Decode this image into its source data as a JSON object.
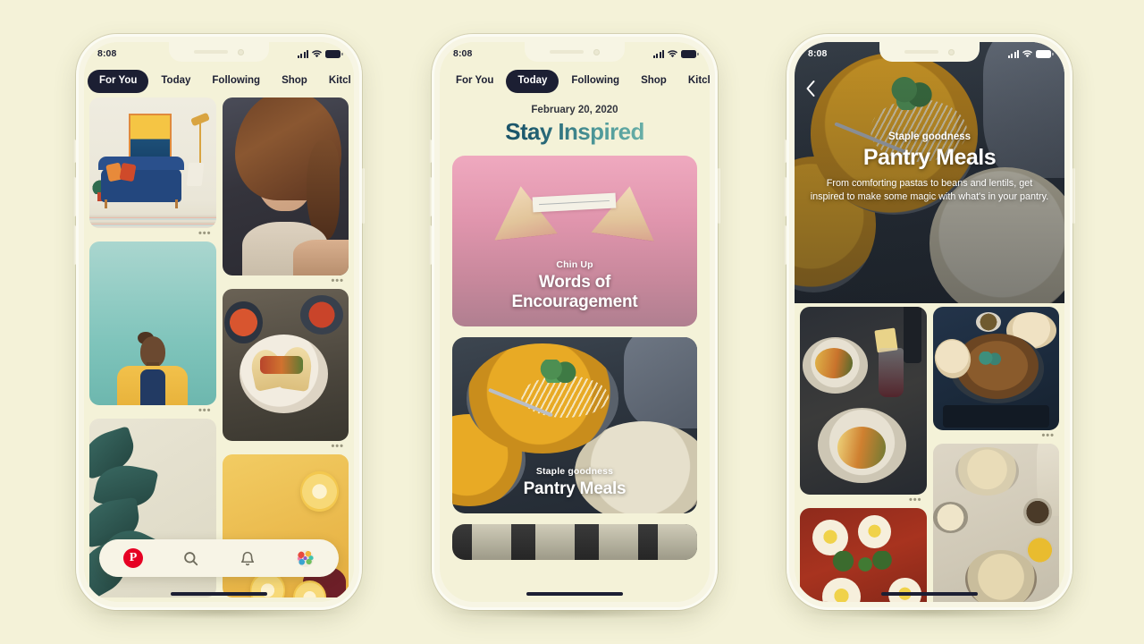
{
  "page": {
    "background_color": "#f4f2d8",
    "device_frame_color": "#f7f5e4"
  },
  "status_bar": {
    "time": "8:08",
    "icons": [
      "cellular-signal-icon",
      "wifi-icon",
      "battery-icon"
    ]
  },
  "phone1": {
    "name": "For You feed",
    "tabs": [
      {
        "label": "For You",
        "active": true
      },
      {
        "label": "Today",
        "active": false
      },
      {
        "label": "Following",
        "active": false
      },
      {
        "label": "Shop",
        "active": false
      },
      {
        "label": "Kitcl",
        "active": false
      }
    ],
    "pins": [
      {
        "name": "living-room-illustration",
        "overflow": "•••"
      },
      {
        "name": "woman-in-yellow-jacket-photo",
        "overflow": "•••"
      },
      {
        "name": "rubber-plant-photo",
        "overflow": ""
      },
      {
        "name": "portrait-woman-photo",
        "overflow": "•••"
      },
      {
        "name": "tacos-plate-photo",
        "overflow": "•••"
      },
      {
        "name": "citrus-yellow-photo",
        "overflow": ""
      }
    ],
    "nav": [
      {
        "name": "home",
        "icon": "pinterest-logo-icon",
        "glyph": "P"
      },
      {
        "name": "search",
        "icon": "search-icon"
      },
      {
        "name": "notifications",
        "icon": "bell-icon"
      },
      {
        "name": "profile",
        "icon": "avatar-icon"
      }
    ]
  },
  "phone2": {
    "name": "Today tab",
    "tabs": [
      {
        "label": "For You",
        "active": false
      },
      {
        "label": "Today",
        "active": true
      },
      {
        "label": "Following",
        "active": false
      },
      {
        "label": "Shop",
        "active": false
      },
      {
        "label": "Kitcl",
        "active": false
      }
    ],
    "date": "February 20, 2020",
    "headline": "Stay Inspired",
    "headline_gradient": [
      "#17485e",
      "#86c7b6"
    ],
    "cards": [
      {
        "name": "words-of-encouragement-card",
        "eyebrow": "Chin Up",
        "title_line1": "Words of",
        "title_line2": "Encouragement",
        "accent": "#e095ad"
      },
      {
        "name": "pantry-meals-card",
        "eyebrow": "Staple goodness",
        "title": "Pantry Meals"
      },
      {
        "name": "window-card-partial",
        "eyebrow": "",
        "title": ""
      }
    ]
  },
  "phone3": {
    "name": "Pantry Meals detail",
    "back_icon": "chevron-left-icon",
    "hero": {
      "eyebrow": "Staple goodness",
      "title": "Pantry Meals",
      "description": "From comforting pastas to beans and lentils, get inspired to make some magic with what's in your pantry."
    },
    "pins": [
      {
        "name": "pasta-wine-dinner-photo",
        "overflow": "•••"
      },
      {
        "name": "shakshuka-skillet-photo",
        "overflow": ""
      },
      {
        "name": "mushroom-naan-skillet-photo",
        "overflow": "•••"
      },
      {
        "name": "pasta-table-spread-photo",
        "overflow": ""
      }
    ]
  }
}
